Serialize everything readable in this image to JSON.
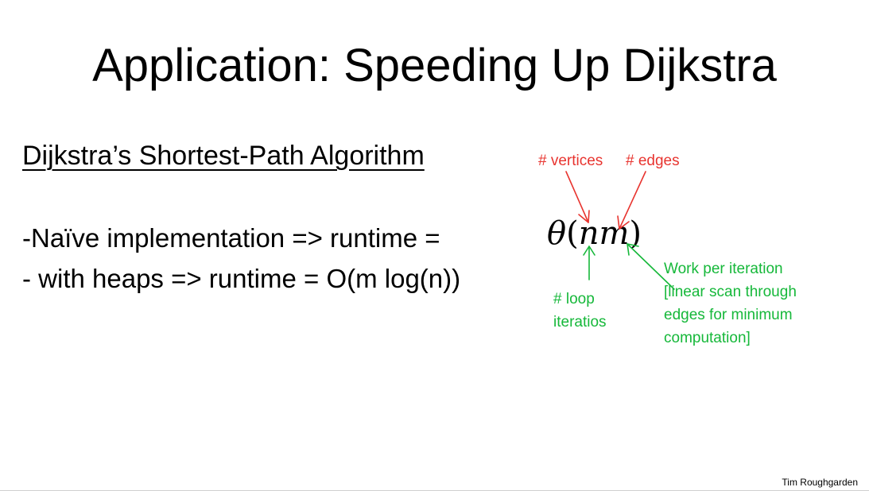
{
  "slide": {
    "title": "Application: Speeding Up Dijkstra",
    "subtitle": "Dijkstra’s Shortest-Path Algorithm",
    "lines": [
      "-Naïve implementation => runtime =",
      "- with heaps => runtime = O(m log(n))"
    ],
    "formula": {
      "theta": "θ",
      "open_paren": "(",
      "body": "nm",
      "close_paren": ")"
    },
    "annotations": {
      "vertices": "# vertices",
      "edges": "# edges",
      "loop_lines": [
        "# loop",
        "iteratios"
      ],
      "work_lines": [
        "Work per iteration",
        "[linear scan through",
        "edges for minimum",
        "computation]"
      ]
    },
    "footer": "Tim Roughgarden"
  },
  "colors": {
    "annotation_red": "#e8342f",
    "annotation_green": "#16b83a",
    "text": "#000000",
    "background": "#ffffff"
  }
}
